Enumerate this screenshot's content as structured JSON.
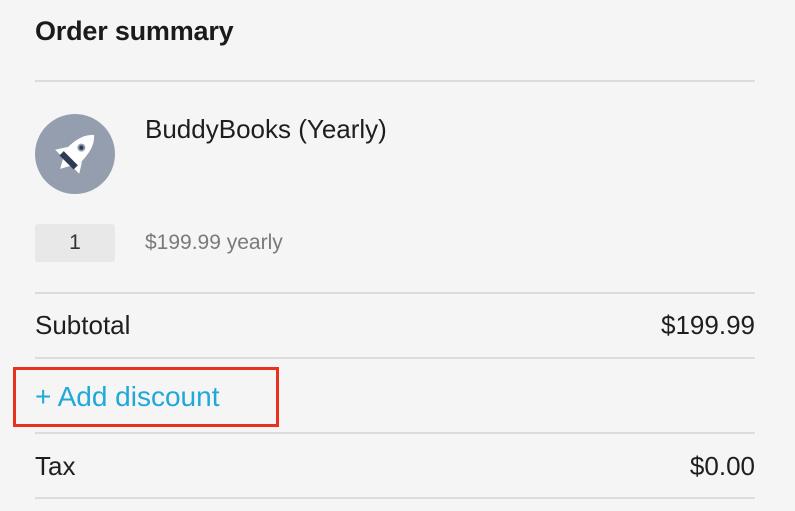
{
  "order_summary": {
    "title": "Order summary",
    "product": {
      "icon": "rocket-icon",
      "name": "BuddyBooks (Yearly)",
      "quantity": "1",
      "price": "$199.99 yearly"
    },
    "subtotal": {
      "label": "Subtotal",
      "value": "$199.99"
    },
    "discount": {
      "label": "+ Add discount"
    },
    "tax": {
      "label": "Tax",
      "value": "$0.00"
    }
  },
  "colors": {
    "background": "#f5f5f5",
    "icon_circle": "#959eae",
    "link": "#1fa8d8",
    "highlight": "#e8321d",
    "divider": "#dcdcdc"
  }
}
